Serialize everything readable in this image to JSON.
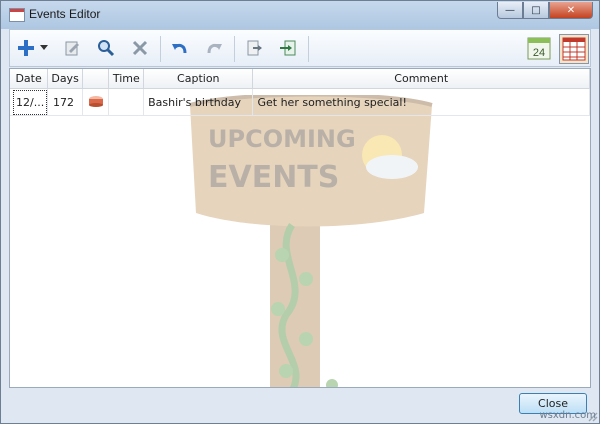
{
  "window": {
    "title": "Events Editor",
    "controls": {
      "minimize": "—",
      "maximize": "□",
      "close": "✕"
    }
  },
  "toolbar": {
    "icons": [
      "add-icon",
      "dropdown-arrow-icon",
      "edit-icon",
      "search-icon",
      "delete-icon",
      "undo-icon",
      "redo-icon",
      "export-icon",
      "import-icon",
      "calendar-24-icon",
      "grid-view-icon"
    ],
    "calendar_day": "24"
  },
  "table": {
    "columns": [
      "Date",
      "Days",
      "",
      "Time",
      "Caption",
      "Comment"
    ],
    "rows": [
      {
        "date": "12/...",
        "days": "172",
        "icon": "cake-icon",
        "time": "",
        "caption": "Bashir's birthday",
        "comment": "Get her something special!"
      }
    ]
  },
  "watermark": {
    "line1": "UPCOMING",
    "line2": "EVENTS"
  },
  "footer": {
    "close_label": "Close"
  },
  "credit": "wsxdn.com",
  "colors": {
    "accent": "#3c7fb1",
    "close_red": "#c4421f"
  }
}
